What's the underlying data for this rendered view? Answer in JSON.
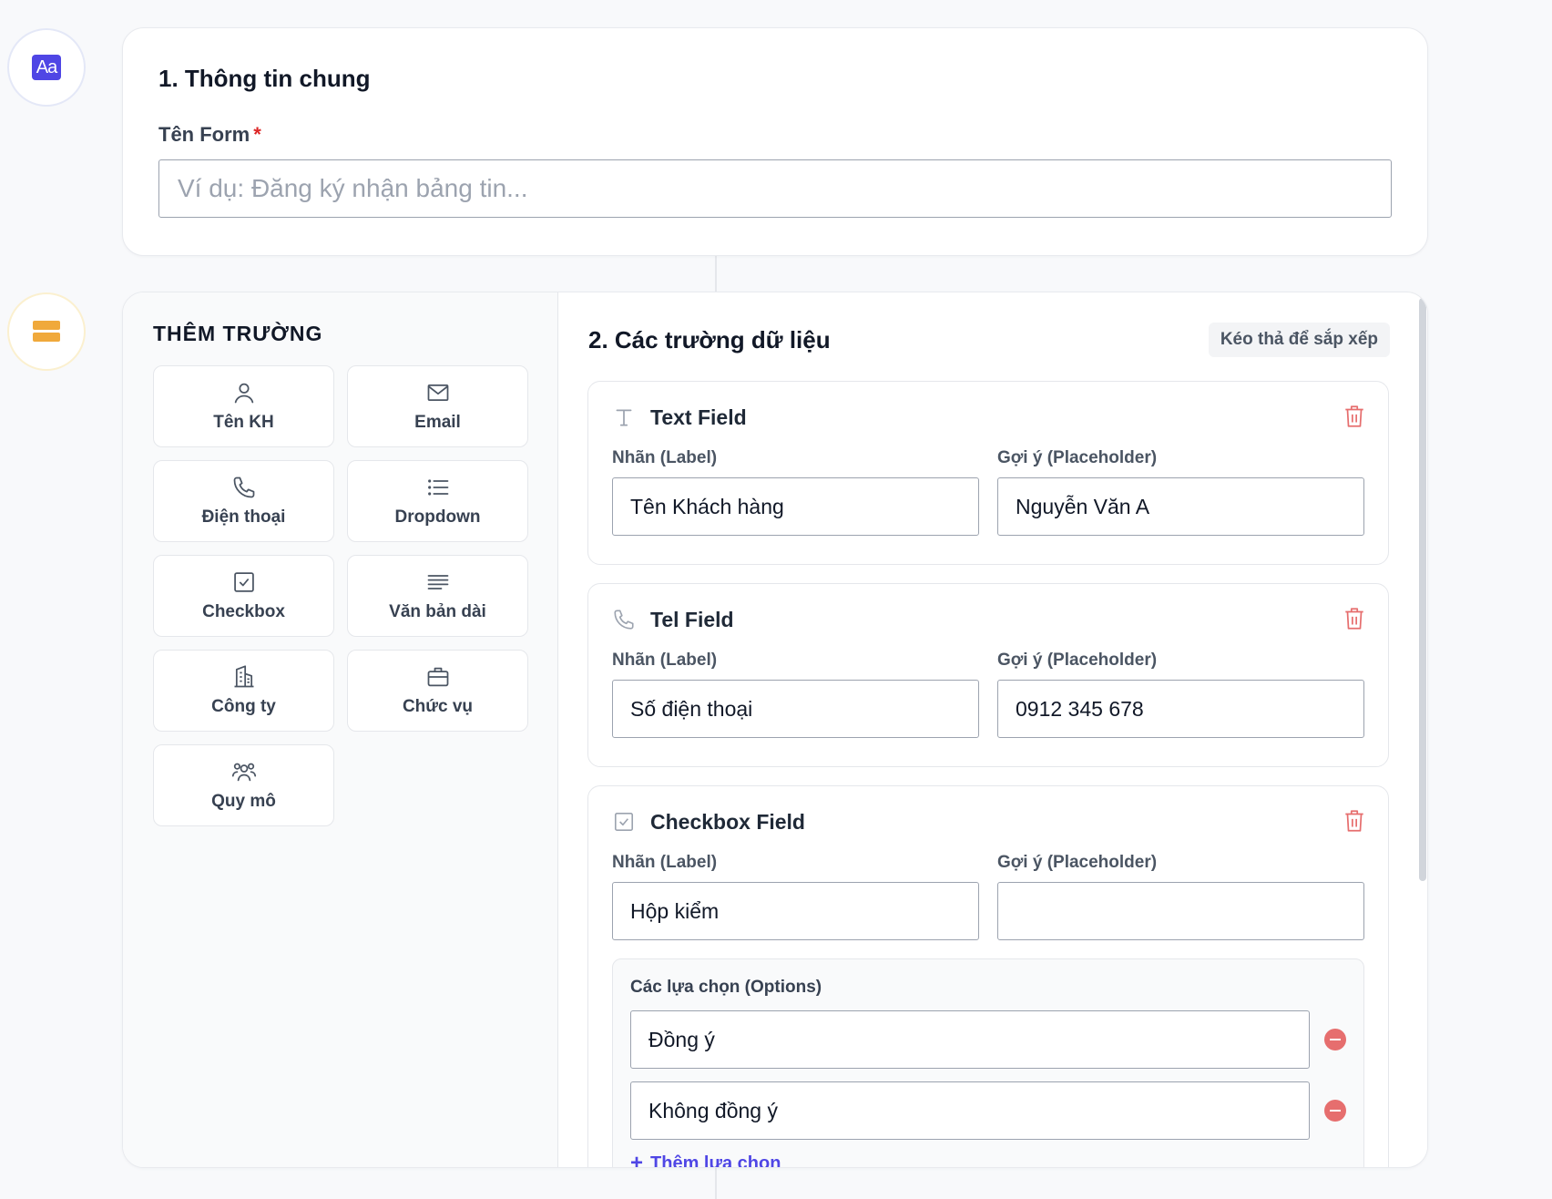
{
  "colors": {
    "accent": "#4f46e5",
    "warning": "#f0a93b",
    "danger": "#e66e6e"
  },
  "general": {
    "title": "1. Thông tin chung",
    "form_name_label": "Tên Form",
    "required_mark": "*",
    "form_name_placeholder": "Ví dụ: Đăng ký nhận bảng tin...",
    "form_name_value": ""
  },
  "palette": {
    "title": "THÊM TRƯỜNG",
    "items": [
      {
        "label": "Tên KH",
        "icon": "user-icon"
      },
      {
        "label": "Email",
        "icon": "mail-icon"
      },
      {
        "label": "Điện thoại",
        "icon": "phone-icon"
      },
      {
        "label": "Dropdown",
        "icon": "list-icon"
      },
      {
        "label": "Checkbox",
        "icon": "checkbox-icon"
      },
      {
        "label": "Văn bản dài",
        "icon": "text-lines-icon"
      },
      {
        "label": "Công ty",
        "icon": "building-icon"
      },
      {
        "label": "Chức vụ",
        "icon": "briefcase-icon"
      },
      {
        "label": "Quy mô",
        "icon": "users-icon"
      }
    ]
  },
  "fields_section": {
    "title": "2. Các trường dữ liệu",
    "drag_hint": "Kéo thả để sắp xếp",
    "label_caption": "Nhãn (Label)",
    "placeholder_caption": "Gợi ý (Placeholder)",
    "fields": [
      {
        "type_title": "Text Field",
        "icon": "text-type-icon",
        "label_value": "Tên Khách hàng",
        "placeholder_value": "Nguyễn Văn A"
      },
      {
        "type_title": "Tel Field",
        "icon": "phone-icon",
        "label_value": "Số điện thoại",
        "placeholder_value": "0912 345 678"
      },
      {
        "type_title": "Checkbox Field",
        "icon": "checkbox-icon",
        "label_value": "Hộp kiểm",
        "placeholder_value": "",
        "options_title": "Các lựa chọn (Options)",
        "options": [
          "Đồng ý",
          "Không đồng ý"
        ],
        "add_option_label": "Thêm lựa chọn"
      }
    ]
  }
}
